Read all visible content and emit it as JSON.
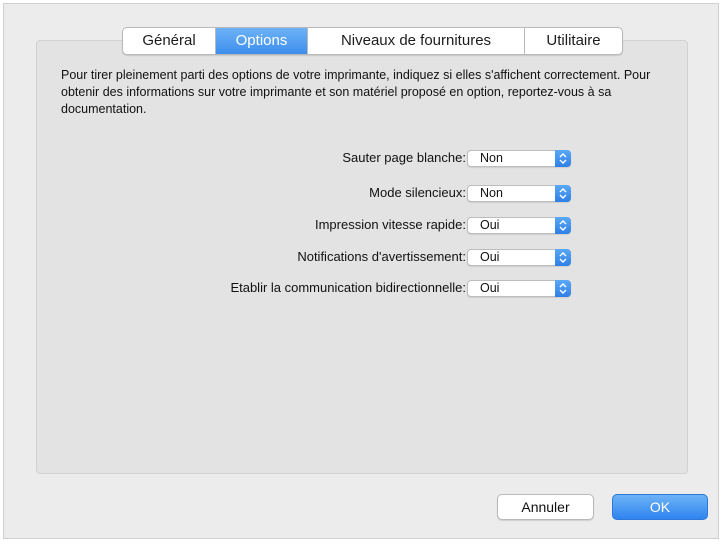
{
  "tabs": [
    {
      "label": "Général",
      "active": false
    },
    {
      "label": "Options",
      "active": true
    },
    {
      "label": "Niveaux de fournitures",
      "active": false
    },
    {
      "label": "Utilitaire",
      "active": false
    }
  ],
  "description": "Pour tirer pleinement parti des options de votre imprimante, indiquez si elles s'affichent correctement. Pour obtenir des informations sur votre imprimante et son matériel proposé en option, reportez-vous à sa documentation.",
  "options": [
    {
      "label": "Sauter page blanche:",
      "value": "Non"
    },
    {
      "label": "Mode silencieux:",
      "value": "Non"
    },
    {
      "label": "Impression vitesse rapide:",
      "value": "Oui"
    },
    {
      "label": "Notifications d'avertissement:",
      "value": "Oui"
    },
    {
      "label": "Etablir la communication bidirectionnelle:",
      "value": "Oui"
    }
  ],
  "buttons": {
    "cancel": "Annuler",
    "ok": "OK"
  },
  "icons": {
    "popup_arrows": "up-down-chevron-icon"
  },
  "colors": {
    "accent": "#3d8eee",
    "panel": "#e3e3e3",
    "window": "#ececec"
  }
}
